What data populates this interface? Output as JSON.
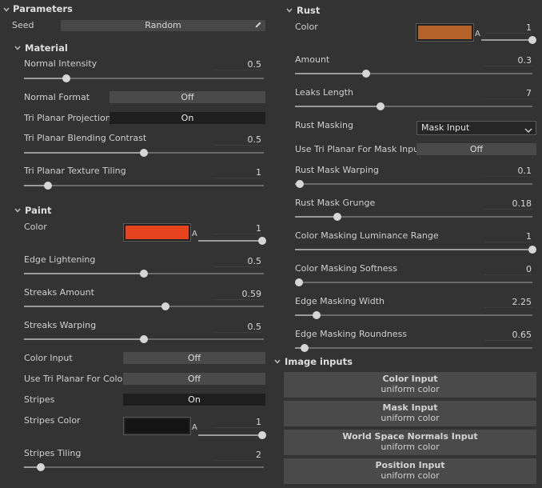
{
  "parameters": {
    "title": "Parameters",
    "seed_label": "Seed",
    "seed_value": "Random"
  },
  "material": {
    "title": "Material",
    "normal_intensity": {
      "label": "Normal Intensity",
      "value": "0.5",
      "fraction": 0.175
    },
    "normal_format": {
      "label": "Normal Format",
      "state": "Off"
    },
    "tri_planar_projection": {
      "label": "Tri Planar Projection",
      "state": "On"
    },
    "tri_planar_blending_contrast": {
      "label": "Tri Planar Blending Contrast",
      "value": "0.5",
      "fraction": 0.5
    },
    "tri_planar_texture_tiling": {
      "label": "Tri Planar Texture Tiling",
      "value": "1",
      "fraction": 0.1
    }
  },
  "paint": {
    "title": "Paint",
    "color": {
      "label": "Color",
      "swatch": "#e6441e",
      "alpha_label": "A",
      "alpha_value": "1",
      "alpha_fraction": 1.0
    },
    "edge_lightening": {
      "label": "Edge Lightening",
      "value": "0.5",
      "fraction": 0.5
    },
    "streaks_amount": {
      "label": "Streaks Amount",
      "value": "0.59",
      "fraction": 0.59
    },
    "streaks_warping": {
      "label": "Streaks Warping",
      "value": "0.5",
      "fraction": 0.5
    },
    "color_input": {
      "label": "Color Input",
      "state": "Off"
    },
    "use_tri_planar_for_color": {
      "label": "Use Tri Planar For Color",
      "state": "Off"
    },
    "stripes": {
      "label": "Stripes",
      "state": "On"
    },
    "stripes_color": {
      "label": "Stripes Color",
      "swatch": "#141414",
      "alpha_label": "A",
      "alpha_value": "1",
      "alpha_fraction": 1.0
    },
    "stripes_tiling": {
      "label": "Stripes Tiling",
      "value": "2",
      "fraction": 0.07
    }
  },
  "rust": {
    "title": "Rust",
    "color": {
      "label": "Color",
      "swatch": "#b5622a",
      "alpha_label": "A",
      "alpha_value": "1",
      "alpha_fraction": 1.0
    },
    "amount": {
      "label": "Amount",
      "value": "0.3",
      "fraction": 0.3
    },
    "leaks_length": {
      "label": "Leaks Length",
      "value": "7",
      "fraction": 0.36
    },
    "rust_masking": {
      "label": "Rust Masking",
      "selected": "Mask Input"
    },
    "use_tri_planar_for_mask_input": {
      "label": "Use Tri Planar For Mask Input",
      "state": "Off"
    },
    "rust_mask_warping": {
      "label": "Rust Mask Warping",
      "value": "0.1",
      "fraction": 0.02
    },
    "rust_mask_grunge": {
      "label": "Rust Mask Grunge",
      "value": "0.18",
      "fraction": 0.18
    },
    "color_masking_luminance_range": {
      "label": "Color Masking Luminance Range",
      "value": "1",
      "fraction": 1.0
    },
    "color_masking_softness": {
      "label": "Color Masking Softness",
      "value": "0",
      "fraction": 0.0
    },
    "edge_masking_width": {
      "label": "Edge Masking Width",
      "value": "2.25",
      "fraction": 0.09
    },
    "edge_masking_roundness": {
      "label": "Edge Masking Roundness",
      "value": "0.65",
      "fraction": 0.04
    }
  },
  "image_inputs": {
    "title": "Image inputs",
    "items": [
      {
        "title": "Color Input",
        "subtitle": "uniform color"
      },
      {
        "title": "Mask Input",
        "subtitle": "uniform color"
      },
      {
        "title": "World Space Normals Input",
        "subtitle": "uniform color"
      },
      {
        "title": "Position Input",
        "subtitle": "uniform color"
      }
    ]
  },
  "colors": {
    "panel_bg": "#333333",
    "toggle_off_bg": "#4a4a4a",
    "toggle_on_bg": "#1e1e1e",
    "knob": "#d6d6d6"
  }
}
